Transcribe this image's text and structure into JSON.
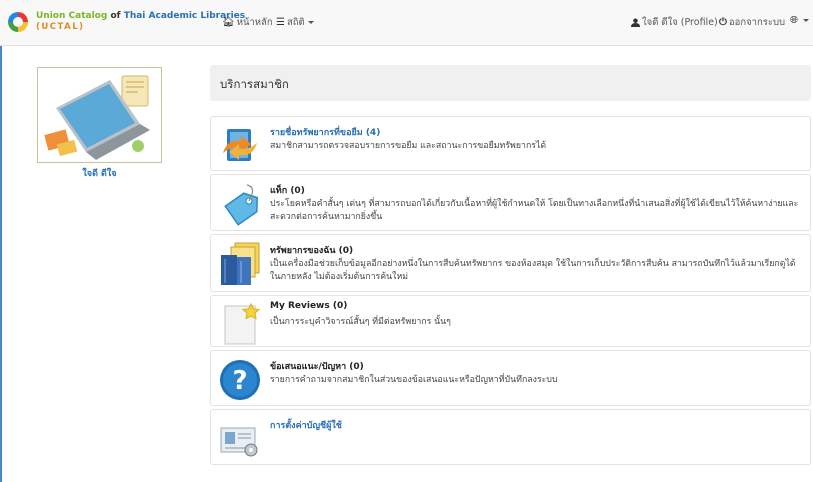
{
  "brand": {
    "line1_a": "Union Catalog",
    "line1_b": "of",
    "line1_c": "Thai Academic Libraries",
    "line2": "(UCTAL)"
  },
  "nav": {
    "home": "หน้าหลัก",
    "stats": "สถิติ",
    "profile": "ใจดี ดีใจ (Profile)",
    "logout": "ออกจากระบบ"
  },
  "user": {
    "name": "ใจดี ดีใจ"
  },
  "section_title": "บริการสมาชิก",
  "cards": [
    {
      "title": "รายชื่อทรัพยากรที่ขอยืม (4)",
      "desc": "สมาชิกสามารถตรวจสอบรายการขอยืม และสถานะการขอยืมทรัพยากรได้",
      "icon": "borrow-icon"
    },
    {
      "title": "แท็ก (0)",
      "desc": "ประโยคหรือคำสั้นๆ เด่นๆ ที่สามารถบอกได้เกี่ยวกับเนื้อหาที่ผู้ใช้กำหนดให้ โดยเป็นทางเลือกหนึ่งที่นำเสนอสิ่งที่ผู้ใช้ได้เขียนไว้ให้ค้นหาง่ายและสะดวกต่อการค้นหามากยิ่งขึ้น",
      "icon": "tag-icon"
    },
    {
      "title": "ทรัพยากรของฉัน (0)",
      "desc": "เป็นเครื่องมือช่วยเก็บข้อมูลอีกอย่างหนึ่งในการสืบค้นทรัพยากร ของห้องสมุด ใช้ในการเก็บประวัติการสืบค้น สามารถบันทึกไว้แล้วมาเรียกดูได้ในภายหลัง ไม่ต้องเริ่มต้นการค้นใหม่",
      "icon": "my-resources-icon"
    },
    {
      "title": "My Reviews (0)",
      "desc": "เป็นการระบุคำวิจารณ์สั้นๆ ที่มีต่อทรัพยากร นั้นๆ",
      "icon": "review-icon"
    },
    {
      "title": "ข้อเสนอแนะ/ปัญหา (0)",
      "desc": "รายการคำถามจากสมาชิกในส่วนของข้อเสนอแนะหรือปัญหาที่บันทึกลงระบบ",
      "icon": "question-icon"
    },
    {
      "title": "การตั้งค่าบัญชีผู้ใช้",
      "desc": "",
      "icon": "account-settings-icon"
    }
  ]
}
